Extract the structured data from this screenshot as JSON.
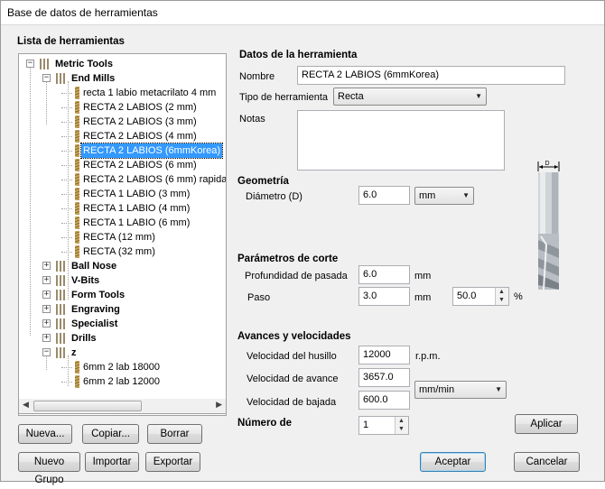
{
  "window": {
    "title": "Base de datos de herramientas"
  },
  "tool_list": {
    "heading": "Lista de herramientas",
    "tree": [
      {
        "label": "Metric Tools",
        "kind": "folder",
        "level": 0,
        "expander": "−"
      },
      {
        "label": "End Mills",
        "kind": "folder",
        "level": 1,
        "expander": "−"
      },
      {
        "label": "recta 1 labio metacrilato 4 mm",
        "kind": "tool",
        "level": 2
      },
      {
        "label": "RECTA 2 LABIOS (2 mm)",
        "kind": "tool",
        "level": 2
      },
      {
        "label": "RECTA 2 LABIOS (3 mm)",
        "kind": "tool",
        "level": 2
      },
      {
        "label": "RECTA 2 LABIOS (4 mm)",
        "kind": "tool",
        "level": 2
      },
      {
        "label": "RECTA 2 LABIOS (6mmKorea)",
        "kind": "tool",
        "level": 2,
        "selected": true
      },
      {
        "label": "RECTA 2 LABIOS (6 mm)",
        "kind": "tool",
        "level": 2
      },
      {
        "label": "RECTA 2 LABIOS (6 mm) rapida",
        "kind": "tool",
        "level": 2
      },
      {
        "label": "RECTA 1 LABIO (3 mm)",
        "kind": "tool",
        "level": 2
      },
      {
        "label": "RECTA 1 LABIO (4 mm)",
        "kind": "tool",
        "level": 2
      },
      {
        "label": "RECTA 1 LABIO (6 mm)",
        "kind": "tool",
        "level": 2
      },
      {
        "label": "RECTA (12 mm)",
        "kind": "tool",
        "level": 2
      },
      {
        "label": "RECTA (32 mm)",
        "kind": "tool",
        "level": 2
      },
      {
        "label": "Ball Nose",
        "kind": "folder",
        "level": 1,
        "expander": "+"
      },
      {
        "label": "V-Bits",
        "kind": "folder",
        "level": 1,
        "expander": "+"
      },
      {
        "label": "Form Tools",
        "kind": "folder",
        "level": 1,
        "expander": "+"
      },
      {
        "label": "Engraving",
        "kind": "folder",
        "level": 1,
        "expander": "+"
      },
      {
        "label": "Specialist",
        "kind": "folder",
        "level": 1,
        "expander": "+"
      },
      {
        "label": "Drills",
        "kind": "folder",
        "level": 1,
        "expander": "+"
      },
      {
        "label": "z",
        "kind": "folder",
        "level": 1,
        "expander": "−"
      },
      {
        "label": "6mm 2 lab 18000",
        "kind": "tool",
        "level": 2
      },
      {
        "label": "6mm 2 lab 12000",
        "kind": "tool",
        "level": 2
      }
    ],
    "buttons": {
      "new": "Nueva...",
      "copy": "Copiar...",
      "delete": "Borrar",
      "new_group": "Nuevo Grupo",
      "import": "Importar",
      "export": "Exportar"
    }
  },
  "tool_data": {
    "heading": "Datos de la herramienta",
    "name_label": "Nombre",
    "name_value": "RECTA 2 LABIOS (6mmKorea)",
    "type_label": "Tipo de herramienta",
    "type_value": "Recta",
    "notes_label": "Notas",
    "notes_value": ""
  },
  "geometry": {
    "heading": "Geometría",
    "diameter_label": "Diámetro (D)",
    "diameter_value": "6.0",
    "unit_value": "mm",
    "diagram_label": "D"
  },
  "cutting": {
    "heading": "Parámetros de corte",
    "pass_depth_label": "Profundidad de pasada",
    "pass_depth_value": "6.0",
    "pass_depth_unit": "mm",
    "stepover_label": "Paso",
    "stepover_value": "3.0",
    "stepover_unit": "mm",
    "stepover_percent": "50.0",
    "percent_sign": "%"
  },
  "feeds": {
    "heading": "Avances y velocidades",
    "spindle_label": "Velocidad del husillo",
    "spindle_value": "12000",
    "spindle_unit": "r.p.m.",
    "feed_label": "Velocidad de avance",
    "feed_value": "3657.0",
    "plunge_label": "Velocidad de bajada",
    "plunge_value": "600.0",
    "rate_unit": "mm/min"
  },
  "tool_number": {
    "heading": "Número de",
    "value": "1"
  },
  "actions": {
    "apply": "Aplicar",
    "ok": "Aceptar",
    "cancel": "Cancelar"
  }
}
